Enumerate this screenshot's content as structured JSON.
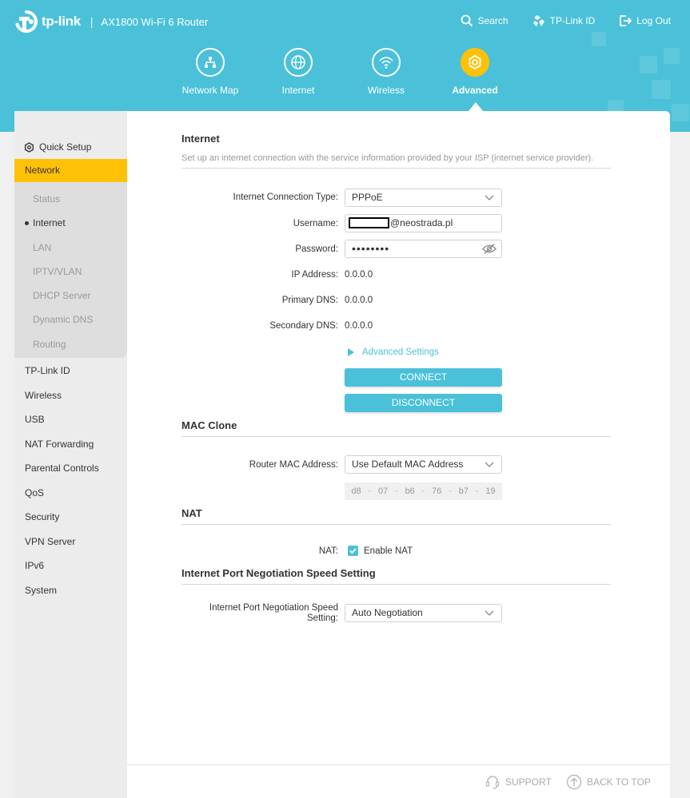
{
  "brand": {
    "logo": "tp-link",
    "separator": "|",
    "model": "AX1800 Wi-Fi 6 Router"
  },
  "topnav": {
    "search": "Search",
    "tplink_id": "TP-Link ID",
    "logout": "Log Out"
  },
  "modes": [
    {
      "label": "Network Map",
      "icon": "network-map-icon"
    },
    {
      "label": "Internet",
      "icon": "globe-icon"
    },
    {
      "label": "Wireless",
      "icon": "wifi-icon"
    },
    {
      "label": "Advanced",
      "icon": "gear-icon",
      "active": true
    }
  ],
  "sidebar": {
    "quick_setup": "Quick Setup",
    "network": "Network",
    "network_sub": [
      "Status",
      "Internet",
      "LAN",
      "IPTV/VLAN",
      "DHCP Server",
      "Dynamic DNS",
      "Routing"
    ],
    "current_sub": "Internet",
    "items": [
      "TP-Link ID",
      "Wireless",
      "USB",
      "NAT Forwarding",
      "Parental Controls",
      "QoS",
      "Security",
      "VPN Server",
      "IPv6",
      "System"
    ]
  },
  "internet": {
    "title": "Internet",
    "description": "Set up an internet connection with the service information provided by your ISP (internet service provider).",
    "conn_type_label": "Internet Connection Type:",
    "conn_type_value": "PPPoE",
    "username_label": "Username:",
    "username_value": "@neostrada.pl",
    "password_label": "Password:",
    "password_value": "••••••••",
    "ip_label": "IP Address:",
    "ip_value": "0.0.0.0",
    "pdns_label": "Primary DNS:",
    "pdns_value": "0.0.0.0",
    "sdns_label": "Secondary DNS:",
    "sdns_value": "0.0.0.0",
    "advanced_settings": "Advanced Settings",
    "connect": "CONNECT",
    "disconnect": "DISCONNECT"
  },
  "mac_clone": {
    "title": "MAC Clone",
    "label": "Router MAC Address:",
    "value": "Use Default MAC Address",
    "mac": [
      "d8",
      "07",
      "b6",
      "76",
      "b7",
      "19"
    ]
  },
  "nat": {
    "title": "NAT",
    "label": "NAT:",
    "checkbox_label": "Enable NAT",
    "checked": true
  },
  "port_speed": {
    "title": "Internet Port Negotiation Speed Setting",
    "label_line1": "Internet Port Negotiation Speed",
    "label_line2": "Setting:",
    "value": "Auto Negotiation"
  },
  "footer": {
    "support": "SUPPORT",
    "back_to_top": "BACK TO TOP"
  },
  "colors": {
    "accent": "#4ac1d8",
    "active": "#ffc107"
  }
}
